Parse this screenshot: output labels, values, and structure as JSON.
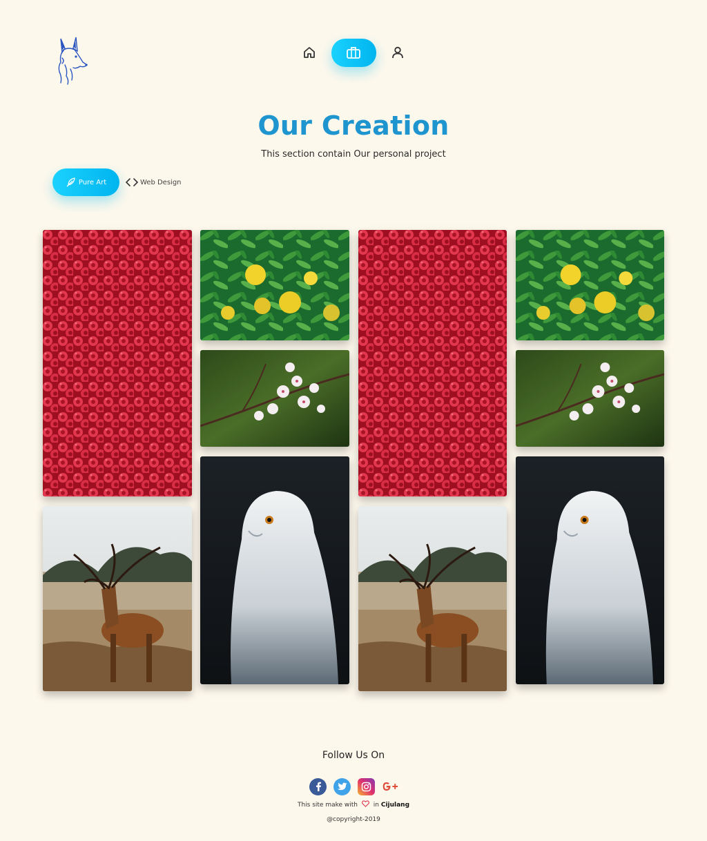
{
  "header": {
    "nav": [
      {
        "name": "home",
        "icon": "home-icon"
      },
      {
        "name": "portfolio",
        "icon": "briefcase-icon",
        "active": true
      },
      {
        "name": "profile",
        "icon": "user-icon"
      }
    ]
  },
  "hero": {
    "title": "Our Creation",
    "subtitle": "This section contain Our personal project"
  },
  "filters": {
    "pure_art": "Pure Art",
    "web_design": "Web Design"
  },
  "gallery": {
    "items": [
      {
        "subject": "raspberries"
      },
      {
        "subject": "lemon tree"
      },
      {
        "subject": "cherry blossom"
      },
      {
        "subject": "deer"
      },
      {
        "subject": "snowy owl"
      },
      {
        "subject": "raspberries"
      },
      {
        "subject": "lemon tree"
      },
      {
        "subject": "cherry blossom"
      },
      {
        "subject": "deer"
      },
      {
        "subject": "snowy owl"
      }
    ]
  },
  "footer": {
    "follow": "Follow Us On",
    "social": [
      "facebook-icon",
      "twitter-icon",
      "instagram-icon",
      "google-plus-icon"
    ],
    "made_prefix": "This site make with",
    "made_in": "in",
    "made_place": "Cijulang",
    "copyright": "@copyright-2019"
  },
  "colors": {
    "background": "#fdf8ec",
    "accent": "#00c2f3",
    "title": "#1f95cf"
  }
}
